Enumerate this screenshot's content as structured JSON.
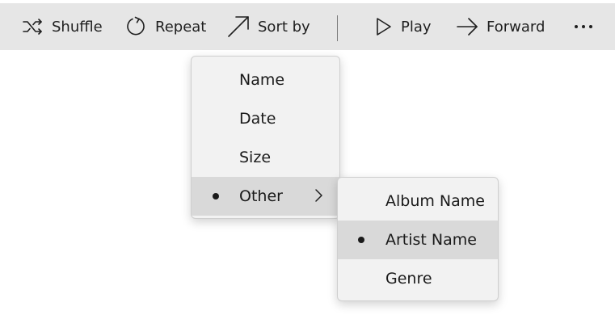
{
  "toolbar": {
    "shuffle_label": "Shuffle",
    "repeat_label": "Repeat",
    "sort_label": "Sort by",
    "play_label": "Play",
    "forward_label": "Forward",
    "more_icon": "more-horizontal-icon"
  },
  "sort_menu": {
    "items": [
      {
        "label": "Name",
        "selected": false
      },
      {
        "label": "Date",
        "selected": false
      },
      {
        "label": "Size",
        "selected": false
      },
      {
        "label": "Other",
        "selected": true,
        "has_submenu": true
      }
    ]
  },
  "other_submenu": {
    "items": [
      {
        "label": "Album Name",
        "selected": false
      },
      {
        "label": "Artist Name",
        "selected": true
      },
      {
        "label": "Genre",
        "selected": false
      }
    ]
  },
  "colors": {
    "toolbar_bg": "#e6e6e6",
    "menu_bg": "#f2f2f2",
    "highlight_bg": "#d9d9d9"
  }
}
